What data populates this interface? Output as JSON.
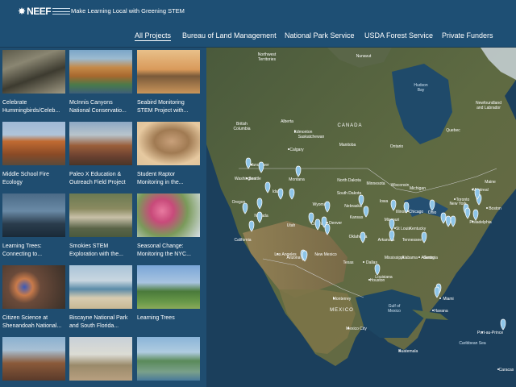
{
  "brand": {
    "logo_text": "NEEF",
    "tagline": "Make Learning Local with Greening STEM"
  },
  "nav": {
    "items": [
      {
        "label": "All Projects",
        "active": true
      },
      {
        "label": "Bureau of Land Management",
        "active": false
      },
      {
        "label": "National Park Service",
        "active": false
      },
      {
        "label": "USDA Forest Service",
        "active": false
      },
      {
        "label": "Private Funders",
        "active": false
      }
    ]
  },
  "projects": [
    {
      "title": "Celebrate\nHummingbirds/Celeb...",
      "scene": "tree-roots"
    },
    {
      "title": "McInnis Canyons\nNational Conservatio...",
      "scene": "canyon-river"
    },
    {
      "title": "Seabird Monitoring\nSTEM Project with...",
      "scene": "sunset-rocks"
    },
    {
      "title": "Middle School Fire\nEcology",
      "scene": "red-cliffs"
    },
    {
      "title": "Paleo X Education &\nOutreach Field Project",
      "scene": "badlands"
    },
    {
      "title": "Student Raptor\nMonitoring in the...",
      "scene": "falcon"
    },
    {
      "title": "Learning Trees:\nConnecting to...",
      "scene": "dusk-trees"
    },
    {
      "title": "Smokies STEM\nExploration with the...",
      "scene": "creek"
    },
    {
      "title": "Seasonal Change:\nMonitoring the NYC...",
      "scene": "blossoms"
    },
    {
      "title": "Citizen Science at\nShenandoah National...",
      "scene": "bluebird"
    },
    {
      "title": "Biscayne National Park\nand South Florida...",
      "scene": "beach"
    },
    {
      "title": "Learning Trees",
      "scene": "meadow"
    },
    {
      "title": "",
      "scene": "hill"
    },
    {
      "title": "",
      "scene": "tree-overlook"
    },
    {
      "title": "",
      "scene": "coast-town"
    }
  ],
  "map": {
    "labels": {
      "countries": [
        "CANADA",
        "MEXICO"
      ],
      "provinces": [
        "Northwest\nTerritories",
        "Nunavut",
        "British\nColumbia",
        "Alberta",
        "Saskatchewan",
        "Manitoba",
        "Ontario",
        "Quebec",
        "Newfoundland\nand Labrador"
      ],
      "water": [
        "Hudson\nBay",
        "Gulf of\nMexico",
        "Caribbean Sea"
      ],
      "states": [
        "Washington",
        "Oregon",
        "California",
        "Nevada",
        "Idaho",
        "Montana",
        "Wyoming",
        "Utah",
        "Arizona",
        "New Mexico",
        "Colorado",
        "North Dakota",
        "South Dakota",
        "Nebraska",
        "Kansas",
        "Oklahoma",
        "Texas",
        "Minnesota",
        "Iowa",
        "Missouri",
        "Arkansas",
        "Wisconsin",
        "Illinois",
        "Michigan",
        "Ohio",
        "Kentucky",
        "Tennessee",
        "Georgia",
        "Alabama",
        "Mississippi",
        "Louisiana",
        "New York",
        "Maine"
      ],
      "cities": [
        "Edmonton",
        "Calgary",
        "Vancouver",
        "Seattle",
        "Denver",
        "Chicago",
        "Toronto",
        "Montreal",
        "Boston",
        "Philadelphia",
        "Los Angeles",
        "Dallas",
        "Houston",
        "Atlanta",
        "St Louis",
        "Monterrey",
        "Mexico City",
        "Havana",
        "Miami",
        "Guatemala",
        "Caracas",
        "Port-au-Prince"
      ]
    },
    "pin_count": 38
  },
  "colors": {
    "header_bg": "#1e4f74",
    "sidebar_bg": "#1f4d70",
    "pin": "#8ec5e8",
    "ocean": "#1b3f5c"
  }
}
